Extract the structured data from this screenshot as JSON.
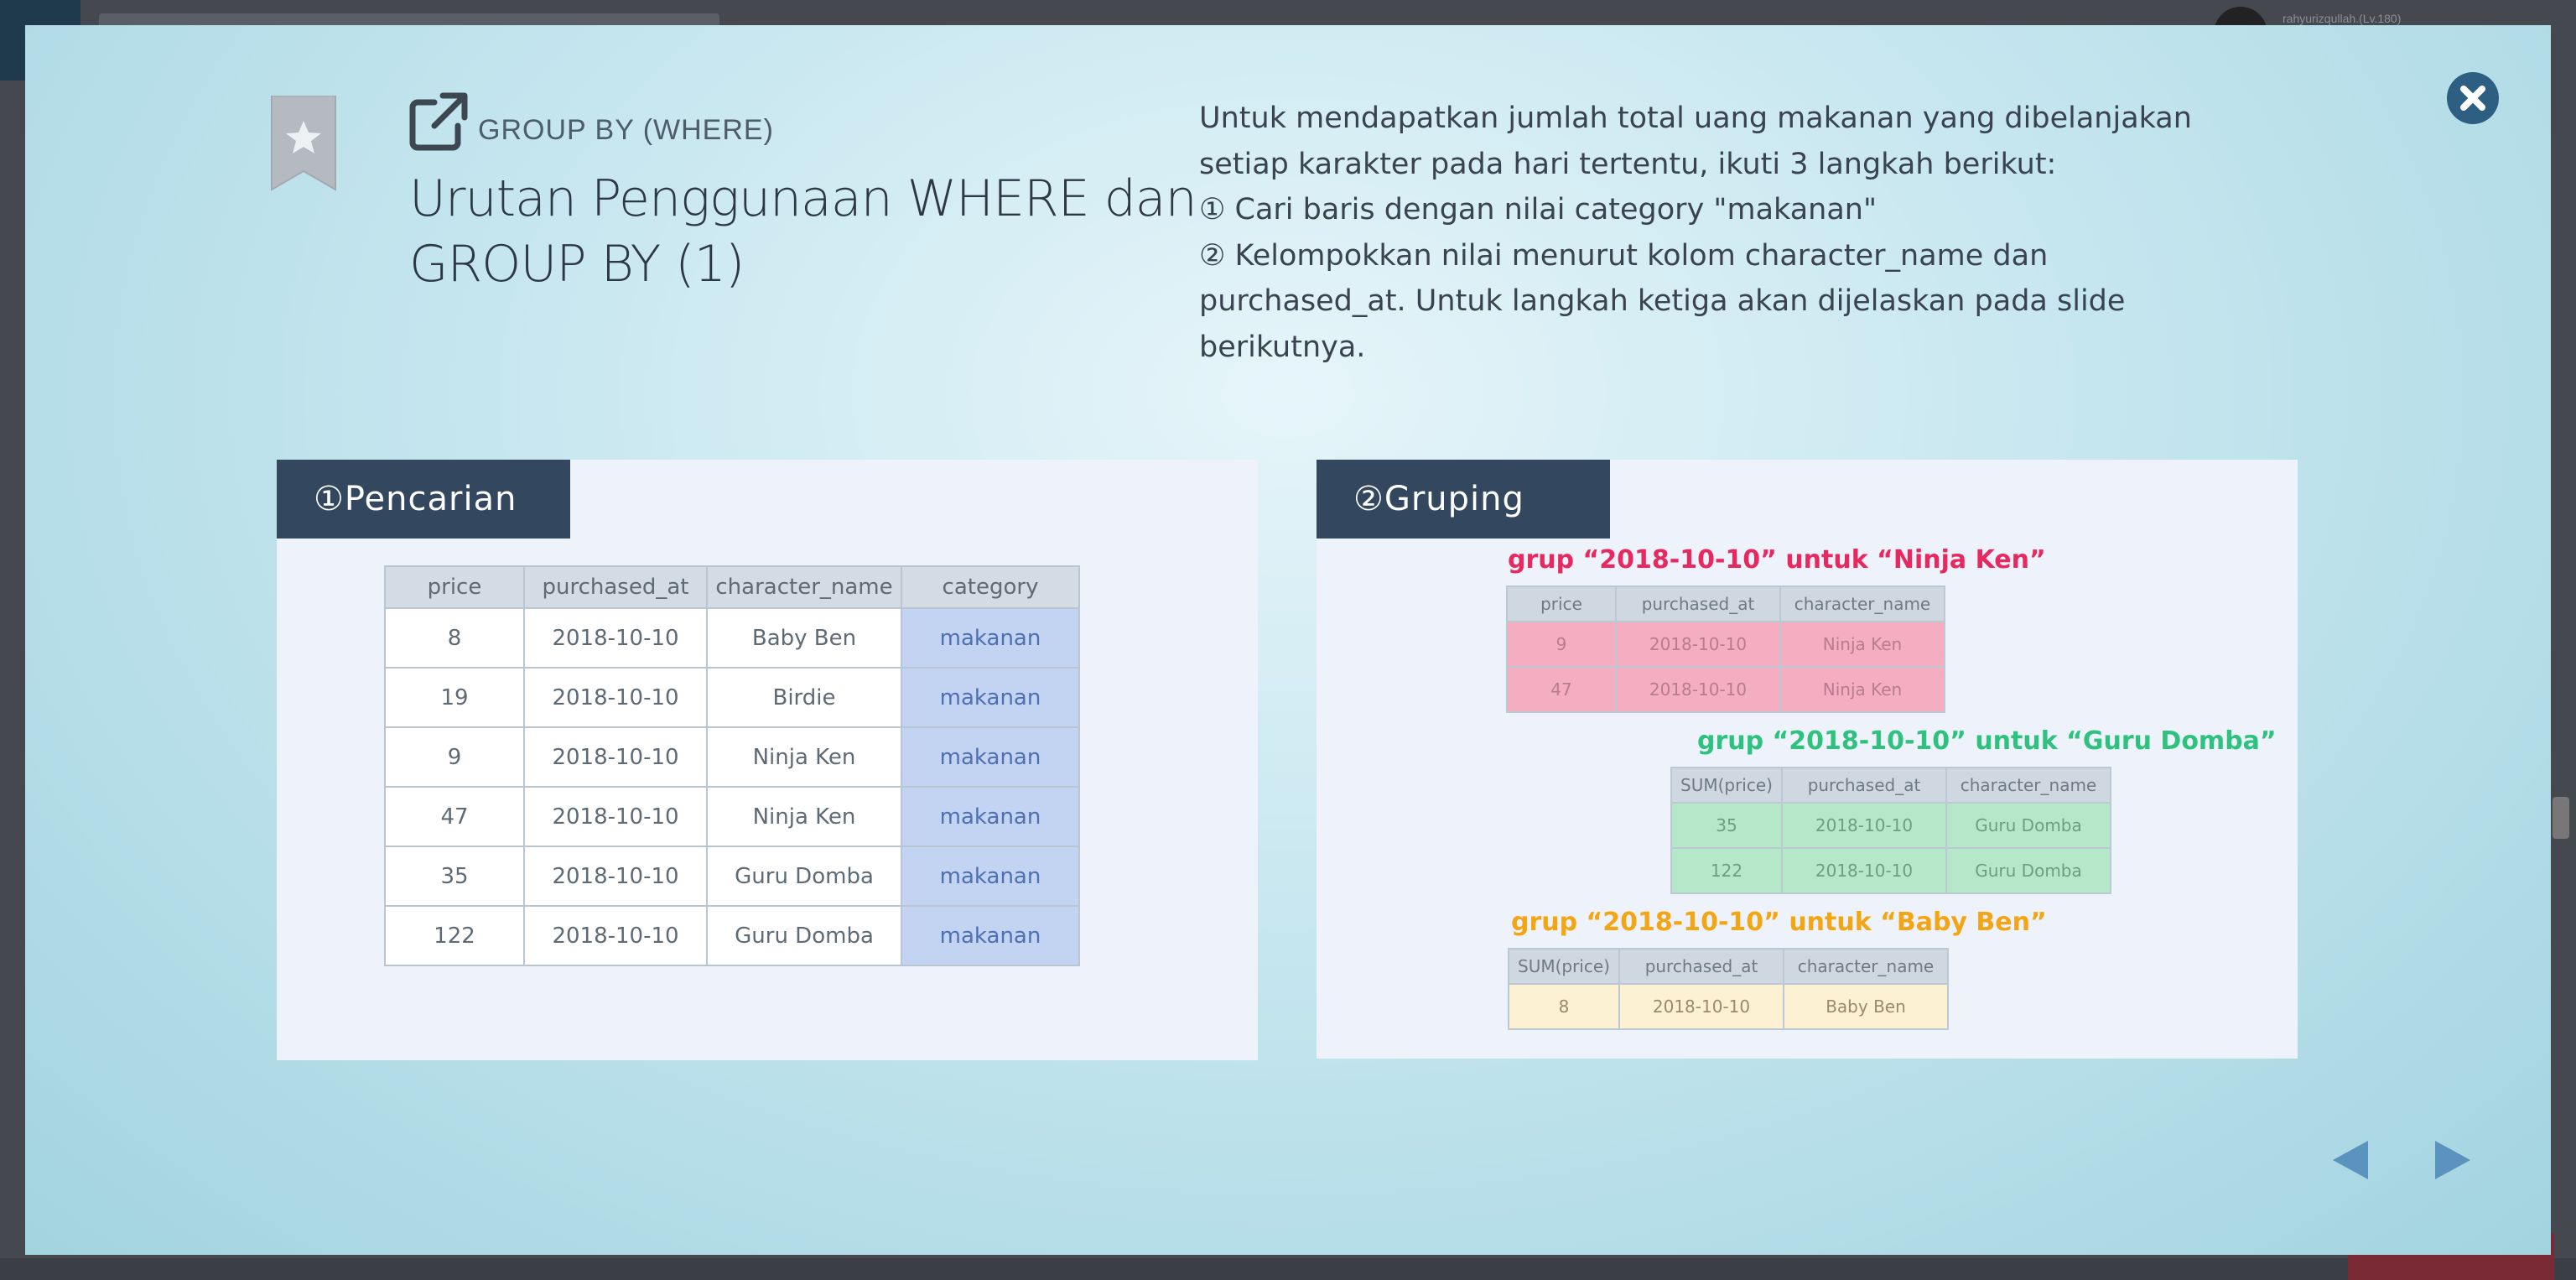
{
  "background": {
    "user_text": "rahyurizqullah.(Lv.180)"
  },
  "header": {
    "subtitle": "GROUP BY (WHERE)",
    "title": "Urutan Penggunaan WHERE dan GROUP BY (1)",
    "description_lines": [
      "Untuk mendapatkan jumlah total uang makanan yang dibelanjakan",
      "setiap karakter pada hari tertentu, ikuti 3 langkah berikut:",
      "① Cari baris dengan nilai category \"makanan\"",
      "② Kelompokkan nilai menurut kolom character_name dan",
      "purchased_at. Untuk langkah ketiga akan dijelaskan pada slide",
      "berikutnya."
    ]
  },
  "left_panel": {
    "title": "①Pencarian",
    "columns": [
      "price",
      "purchased_at",
      "character_name",
      "category"
    ],
    "rows": [
      [
        "8",
        "2018-10-10",
        "Baby Ben",
        "makanan"
      ],
      [
        "19",
        "2018-10-10",
        "Birdie",
        "makanan"
      ],
      [
        "9",
        "2018-10-10",
        "Ninja Ken",
        "makanan"
      ],
      [
        "47",
        "2018-10-10",
        "Ninja Ken",
        "makanan"
      ],
      [
        "35",
        "2018-10-10",
        "Guru Domba",
        "makanan"
      ],
      [
        "122",
        "2018-10-10",
        "Guru Domba",
        "makanan"
      ]
    ]
  },
  "right_panel": {
    "title": "②Gruping",
    "groups": [
      {
        "label": "grup “2018-10-10” untuk “Ninja Ken”",
        "color": "#e8295f",
        "columns": [
          "price",
          "purchased_at",
          "character_name"
        ],
        "rows": [
          [
            "9",
            "2018-10-10",
            "Ninja Ken"
          ],
          [
            "47",
            "2018-10-10",
            "Ninja Ken"
          ]
        ]
      },
      {
        "label": "grup “2018-10-10” untuk “Guru Domba”",
        "color": "#2ec27e",
        "columns": [
          "SUM(price)",
          "purchased_at",
          "character_name"
        ],
        "rows": [
          [
            "35",
            "2018-10-10",
            "Guru Domba"
          ],
          [
            "122",
            "2018-10-10",
            "Guru Domba"
          ]
        ]
      },
      {
        "label": "grup “2018-10-10” untuk “Baby Ben”",
        "color": "#f3a514",
        "columns": [
          "SUM(price)",
          "purchased_at",
          "character_name"
        ],
        "rows": [
          [
            "8",
            "2018-10-10",
            "Baby Ben"
          ]
        ]
      }
    ]
  },
  "icons": {
    "bookmark": "bookmark-star-icon",
    "external": "external-link-icon",
    "close": "close-icon",
    "prev": "prev-arrow-icon",
    "next": "next-arrow-icon"
  },
  "colors": {
    "panel_header": "#33485f",
    "close_button": "#2c5f82",
    "nav_arrow": "#5a93bd",
    "category_highlight": "#c2d4f2"
  }
}
